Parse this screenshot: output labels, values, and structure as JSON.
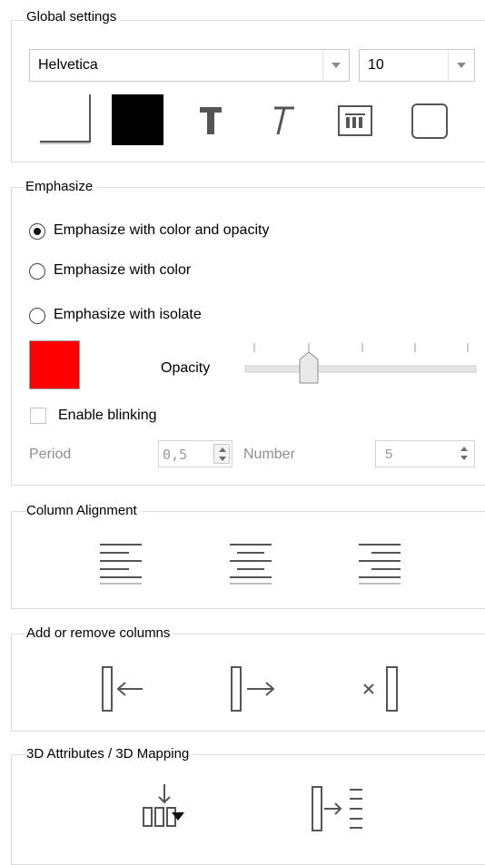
{
  "global": {
    "title": "Global settings",
    "font_family": "Helvetica",
    "font_size": "10",
    "text_color": "#000000",
    "buttons": [
      "border-style-button",
      "text-color-button",
      "bold-text-button",
      "italic-text-button",
      "column-spacing-button",
      "frame-button"
    ]
  },
  "emphasize": {
    "title": "Emphasize",
    "options": [
      {
        "label": "Emphasize with color and opacity",
        "selected": true
      },
      {
        "label": "Emphasize with color",
        "selected": false
      },
      {
        "label": "Emphasize with isolate",
        "selected": false
      }
    ],
    "color": "#ff0000",
    "opacity_label": "Opacity",
    "opacity_value": 0.25,
    "blink_label": "Enable blinking",
    "blink_checked": false,
    "period_label": "Period",
    "period_value": "0,5",
    "number_label": "Number",
    "number_value": "5"
  },
  "column_alignment": {
    "title": "Column Alignment",
    "icons": [
      "align-left-icon",
      "align-center-icon",
      "align-right-icon"
    ]
  },
  "add_remove": {
    "title": "Add or remove columns",
    "icons": [
      "add-column-left-icon",
      "add-column-right-icon",
      "remove-column-icon"
    ]
  },
  "attributes": {
    "title": "3D Attributes / 3D Mapping",
    "icons": [
      "insert-attribute-icon",
      "map-columns-icon"
    ]
  }
}
